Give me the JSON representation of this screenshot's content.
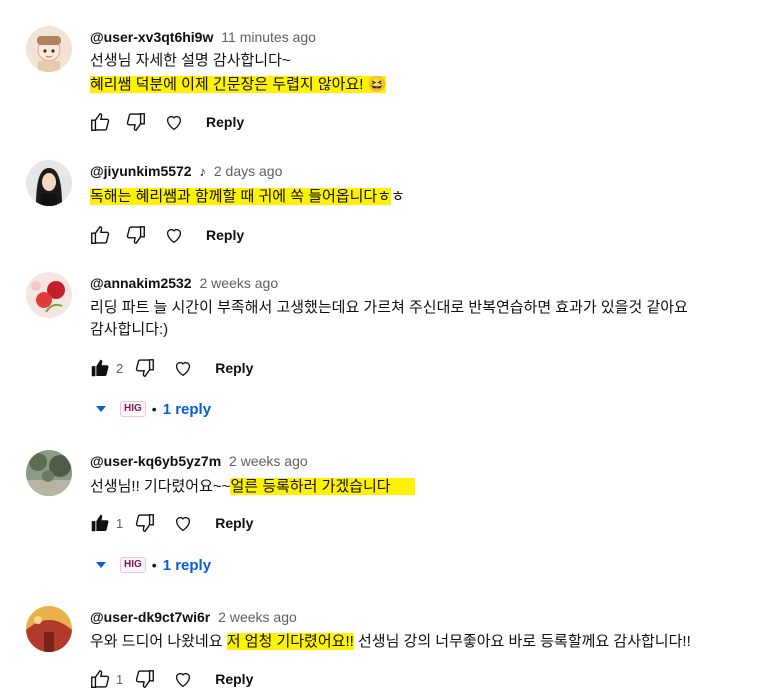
{
  "colors": {
    "highlight": "#fff200",
    "link": "#065fd4"
  },
  "comments": [
    {
      "author": "@user-xv3qt6hi9w",
      "time": "11 minutes ago",
      "text": [
        "선생님 자세한 설명 감사합니다~"
      ],
      "highlight": "혜리쌤 덕분에 이제 긴문장은 두렵지 않아요! 😆",
      "likes": "",
      "reply_label": "Reply"
    },
    {
      "author": "@jiyunkim5572",
      "note": "♪",
      "time": "2 days ago",
      "highlight": "독해는 혜리쌤과 함께할 때 귀에 쏙 들어옵니다ㅎ",
      "highlight_tail": "ㅎ",
      "likes": "",
      "reply_label": "Reply"
    },
    {
      "author": "@annakim2532",
      "time": "2 weeks ago",
      "text": [
        "리딩 파트 늘 시간이 부족해서 고생했는데요 가르쳐 주신대로 반복연습하면 효과가 있을것 같아요",
        "감사합니다:)"
      ],
      "likes": "2",
      "reply_label": "Reply",
      "replies_badge": "HIG",
      "replies_label": "1 reply"
    },
    {
      "author": "@user-kq6yb5yz7m",
      "time": "2 weeks ago",
      "pre": "선생님!! 기다렸어요~~",
      "highlight": "얼른 등록하러 가겠습니다",
      "likes": "1",
      "reply_label": "Reply",
      "replies_badge": "HIG",
      "replies_label": "1 reply"
    },
    {
      "author": "@user-dk9ct7wi6r",
      "time": "2 weeks ago",
      "pre": "우와 드디어 나왔네요 ",
      "highlight": "저 엄청 기다렸어요!!",
      "post": " 선생님 강의 너무좋아요 바로 등록할께요 감사합니다!!",
      "likes": "1",
      "reply_label": "Reply"
    }
  ]
}
